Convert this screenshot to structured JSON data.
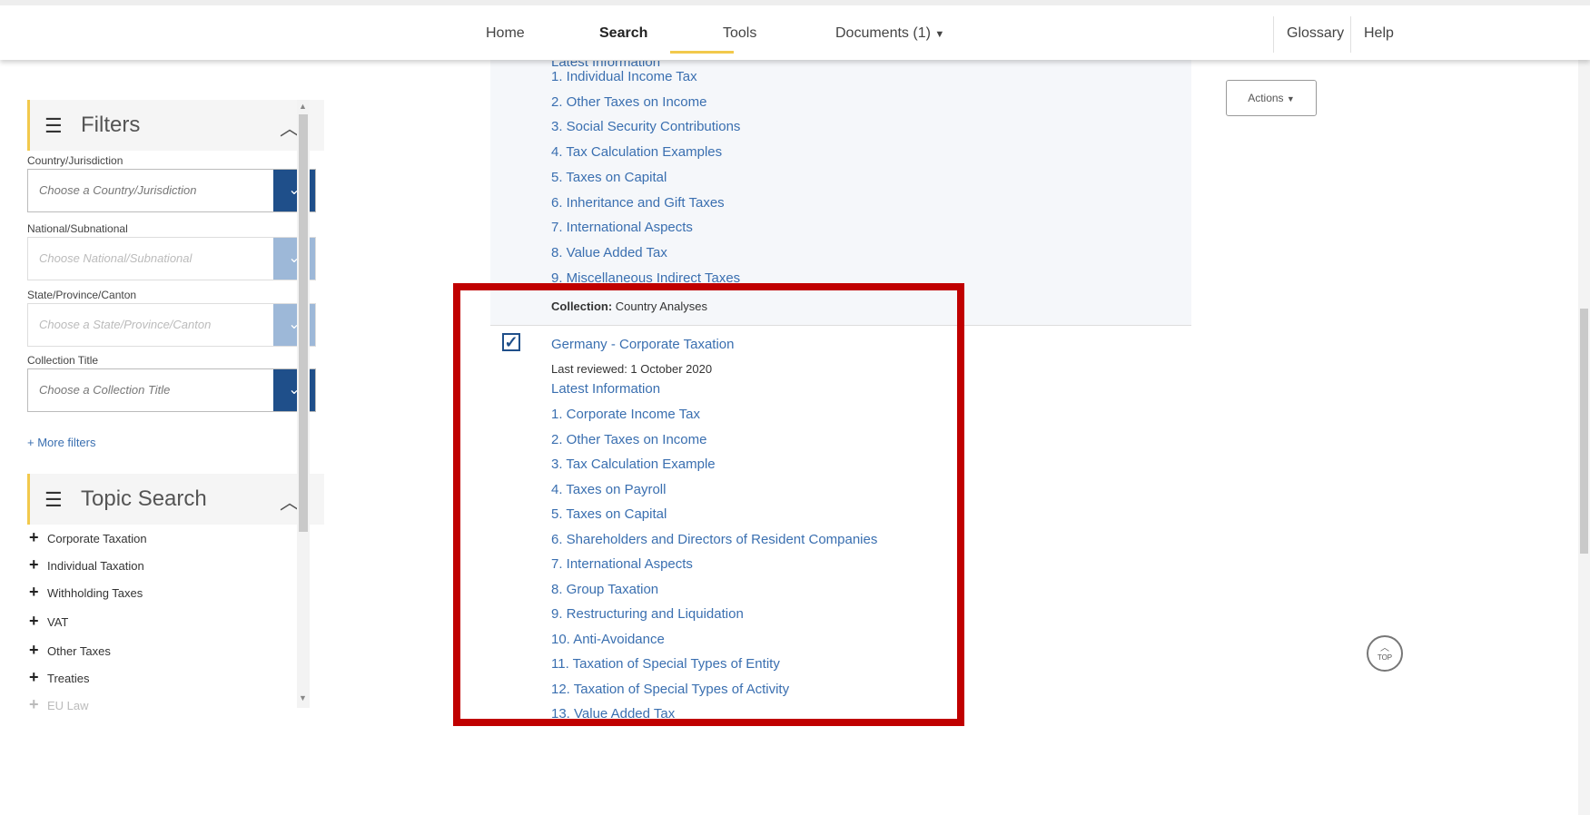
{
  "nav": {
    "home": "Home",
    "search": "Search",
    "tools": "Tools",
    "documents": "Documents (1)",
    "glossary": "Glossary",
    "help": "Help"
  },
  "filters": {
    "title": "Filters",
    "country_label": "Country/Jurisdiction",
    "country_placeholder": "Choose a Country/Jurisdiction",
    "national_label": "National/Subnational",
    "national_placeholder": "Choose National/Subnational",
    "state_label": "State/Province/Canton",
    "state_placeholder": "Choose a State/Province/Canton",
    "collection_label": "Collection Title",
    "collection_placeholder": "Choose a Collection Title",
    "more": "+ More filters"
  },
  "topic_search": {
    "title": "Topic Search",
    "items": [
      "Corporate Taxation",
      "Individual Taxation",
      "Withholding Taxes",
      "VAT",
      "Other Taxes",
      "Treaties",
      "EU Law"
    ]
  },
  "results": {
    "top_partial": "Latest Information",
    "top_items": [
      "1. Individual Income Tax",
      "2. Other Taxes on Income",
      "3. Social Security Contributions",
      "4. Tax Calculation Examples",
      "5. Taxes on Capital",
      "6. Inheritance and Gift Taxes",
      "7. International Aspects",
      "8. Value Added Tax",
      "9. Miscellaneous Indirect Taxes"
    ],
    "collection_label": "Collection:",
    "collection_value": "Country Analyses",
    "doc_title": "Germany - Corporate Taxation",
    "reviewed": "Last reviewed: 1 October 2020",
    "latest": "Latest Information",
    "doc_items": [
      "1. Corporate Income Tax",
      "2. Other Taxes on Income",
      "3. Tax Calculation Example",
      "4. Taxes on Payroll",
      "5. Taxes on Capital",
      "6. Shareholders and Directors of Resident Companies",
      "7. International Aspects",
      "8. Group Taxation",
      "9. Restructuring and Liquidation",
      "10. Anti-Avoidance",
      "11. Taxation of Special Types of Entity",
      "12. Taxation of Special Types of Activity",
      "13. Value Added Tax"
    ]
  },
  "actions": {
    "label": "Actions"
  },
  "to_top": {
    "label": "TOP"
  },
  "colors": {
    "accent": "#1f4f8a",
    "link": "#3a6fb0",
    "highlight": "#c00000",
    "tab_marker": "#f2c94c"
  }
}
